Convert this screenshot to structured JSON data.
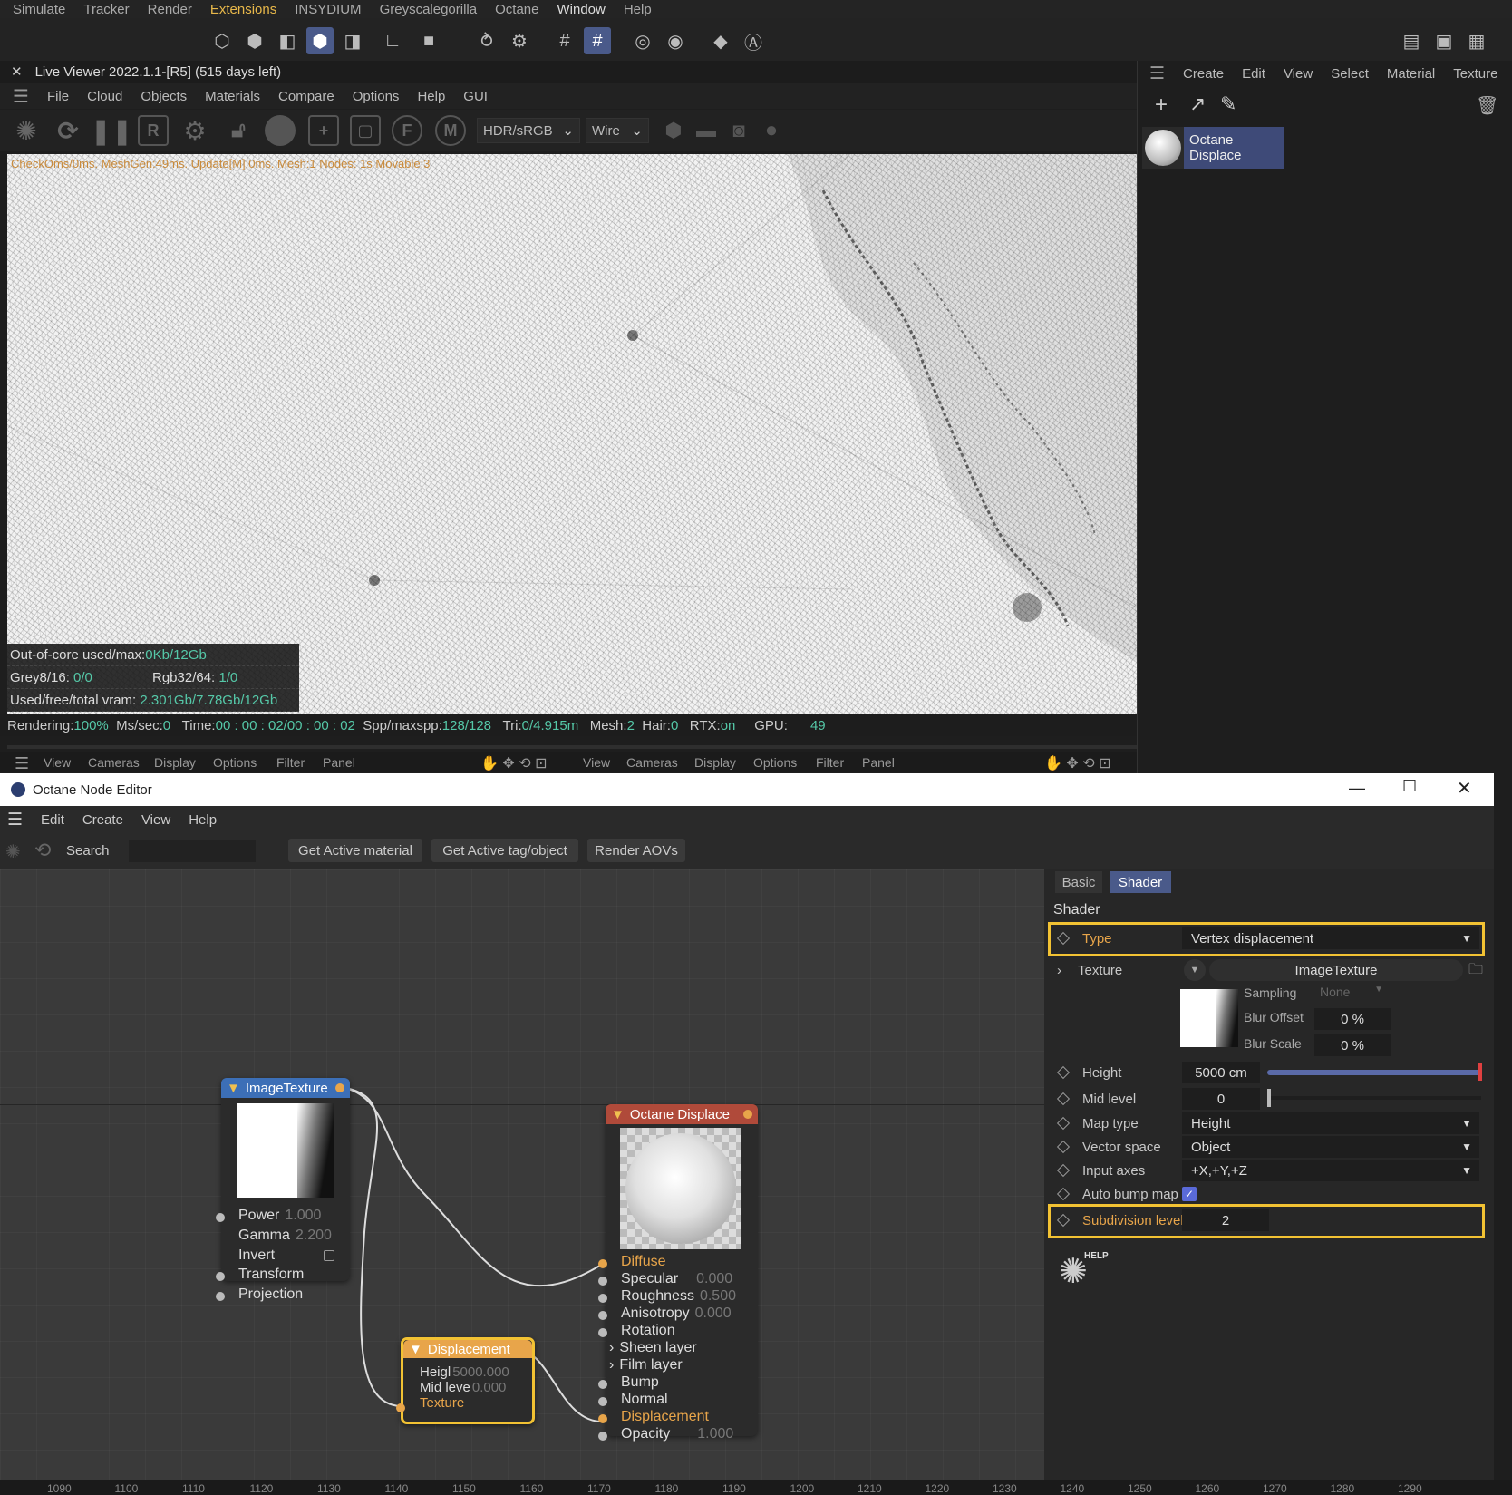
{
  "top_menu": [
    "Simulate",
    "Tracker",
    "Render",
    "Extensions",
    "INSYDIUM",
    "Greyscalegorilla",
    "Octane",
    "Window",
    "Help"
  ],
  "live_viewer": {
    "title": "Live Viewer 2022.1.1-[R5] (515 days left)",
    "menu": [
      "File",
      "Cloud",
      "Objects",
      "Materials",
      "Compare",
      "Options",
      "Help",
      "GUI"
    ],
    "color_mode": "HDR/sRGB",
    "render_mode": "Wire",
    "status_line": "CheckOms/0ms. MeshGen:49ms. Update[M]:0ms. Mesh:1 Nodes: 1s Movable:3",
    "stats": {
      "out_of_core_label": "Out-of-core used/max:",
      "out_of_core_value": "0Kb/12Gb",
      "grey_label": "Grey8/16:",
      "grey_value": "0/0",
      "rgb_label": "Rgb32/64:",
      "rgb_value": "1/0",
      "vram_label": "Used/free/total vram:",
      "vram_value": "2.301Gb/7.78Gb/12Gb"
    },
    "render_bar": {
      "rendering_label": "Rendering:",
      "rendering_value": "100%",
      "ms_label": "Ms/sec:",
      "ms_value": "0",
      "time_label": "Time:",
      "time_value": "00 : 00 : 02/00 : 00 : 02",
      "spp_label": "Spp/maxspp:",
      "spp_value": "128/128",
      "tri_label": "Tri:",
      "tri_value": "0/4.915m",
      "mesh_label": "Mesh:",
      "mesh_value": "2",
      "hair_label": "Hair:",
      "hair_value": "0",
      "rtx_label": "RTX:",
      "rtx_value": "on",
      "gpu_label": "GPU:",
      "gpu_value": "49"
    },
    "bottom_menu_left": [
      "View",
      "Cameras",
      "Display",
      "Options",
      "Filter",
      "Panel"
    ],
    "bottom_menu_right": [
      "View",
      "Cameras",
      "Display",
      "Options",
      "Filter",
      "Panel"
    ]
  },
  "material_manager": {
    "menu": [
      "Create",
      "Edit",
      "View",
      "Select",
      "Material",
      "Texture"
    ],
    "material_name": "Octane Displace"
  },
  "node_editor": {
    "title": "Octane Node Editor",
    "menu": [
      "Edit",
      "Create",
      "View",
      "Help"
    ],
    "search_label": "Search",
    "buttons": [
      "Get Active material",
      "Get Active tag/object",
      "Render AOVs"
    ],
    "image_texture_node": {
      "title": "ImageTexture",
      "rows": [
        {
          "label": "Power",
          "value": "1.000"
        },
        {
          "label": "Gamma",
          "value": "2.200"
        },
        {
          "label": "Invert",
          "value": ""
        },
        {
          "label": "Transform",
          "value": ""
        },
        {
          "label": "Projection",
          "value": ""
        }
      ]
    },
    "displacement_node": {
      "title": "Displacement",
      "rows": [
        {
          "label": "Heigl",
          "value": "5000.000"
        },
        {
          "label": "Mid leve",
          "value": "0.000"
        },
        {
          "label": "Texture",
          "value": ""
        }
      ]
    },
    "material_node": {
      "title": "Octane Displace",
      "rows": [
        {
          "label": "Diffuse",
          "value": ""
        },
        {
          "label": "Specular",
          "value": "0.000"
        },
        {
          "label": "Roughness",
          "value": "0.500"
        },
        {
          "label": "Anisotropy",
          "value": "0.000"
        },
        {
          "label": "Rotation",
          "value": ""
        },
        {
          "label": "Sheen layer",
          "value": ""
        },
        {
          "label": "Film layer",
          "value": ""
        },
        {
          "label": "Bump",
          "value": ""
        },
        {
          "label": "Normal",
          "value": ""
        },
        {
          "label": "Displacement",
          "value": ""
        },
        {
          "label": "Opacity",
          "value": "1.000"
        }
      ]
    }
  },
  "attributes": {
    "tabs": [
      "Basic",
      "Shader"
    ],
    "section": "Shader",
    "type_label": "Type",
    "type_value": "Vertex displacement",
    "texture_label": "Texture",
    "texture_value": "ImageTexture",
    "sampling_label": "Sampling",
    "sampling_value": "None",
    "blur_offset_label": "Blur Offset",
    "blur_offset_value": "0 %",
    "blur_scale_label": "Blur Scale",
    "blur_scale_value": "0 %",
    "height_label": "Height",
    "height_value": "5000 cm",
    "midlevel_label": "Mid level",
    "midlevel_value": "0",
    "maptype_label": "Map type",
    "maptype_value": "Height",
    "vectorspace_label": "Vector space",
    "vectorspace_value": "Object",
    "inputaxes_label": "Input axes",
    "inputaxes_value": "+X,+Y,+Z",
    "autobump_label": "Auto bump map",
    "subdiv_label": "Subdivision level",
    "subdiv_value": "2",
    "help_label": "HELP"
  },
  "timeline_ticks": [
    "1090",
    "1100",
    "1110",
    "1120",
    "1130",
    "1140",
    "1150",
    "1160",
    "1170",
    "1180",
    "1190",
    "1200",
    "1210",
    "1220",
    "1230",
    "1240",
    "1250",
    "1260",
    "1270",
    "1280",
    "1290"
  ],
  "colors": {
    "accent_orange": "#e8a54a",
    "highlight_yellow": "#f2c233",
    "selected_blue": "#4a5a8a",
    "stat_green": "#55c8a8"
  }
}
